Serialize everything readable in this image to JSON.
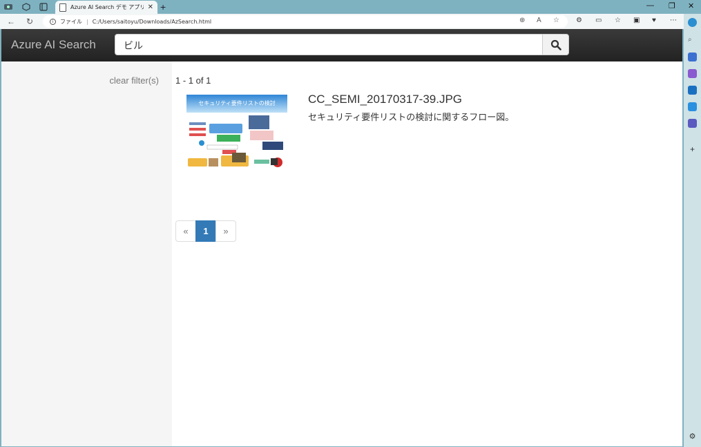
{
  "browser": {
    "tab_title": "Azure AI Search デモ アプリ",
    "address_label": "ファイル",
    "address_url": "C:/Users/saitoyu/Downloads/AzSearch.html"
  },
  "app": {
    "brand": "Azure AI Search",
    "search_value": "ビル"
  },
  "sidebar": {
    "clear_filters": "clear filter(s)"
  },
  "results": {
    "count_text": "1 - 1 of 1",
    "items": [
      {
        "title": "CC_SEMI_20170317-39.JPG",
        "description": "セキュリティ要件リストの検討に関するフロー図。",
        "thumb_caption": "セキュリティ要件リストの検討"
      }
    ]
  },
  "pager": {
    "prev": "«",
    "current": "1",
    "next": "»"
  },
  "colors": {
    "header_bg": "#2b2b2b",
    "accent": "#337ab7",
    "sidebar_bg": "#f5f5f5"
  }
}
